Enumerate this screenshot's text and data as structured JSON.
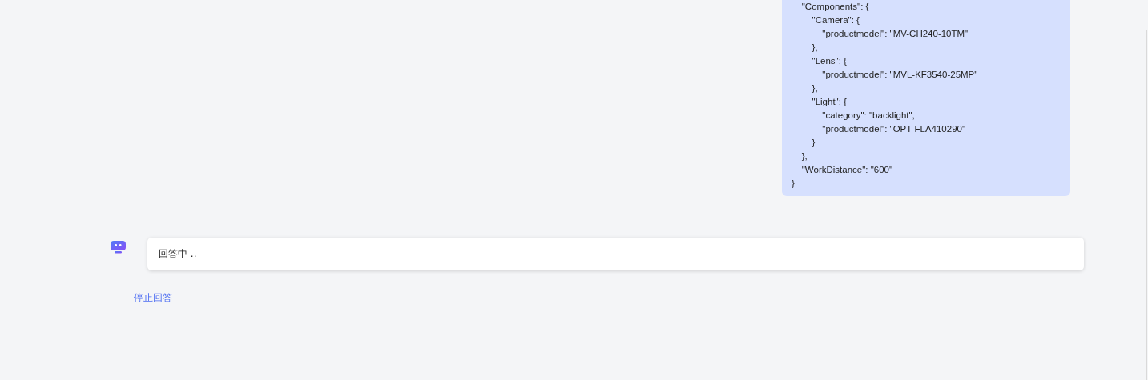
{
  "user_message": {
    "code": "    \"Components\": {\n        \"Camera\": {\n            \"productmodel\": \"MV-CH240-10TM\"\n        },\n        \"Lens\": {\n            \"productmodel\": \"MVL-KF3540-25MP\"\n        },\n        \"Light\": {\n            \"category\": \"backlight\",\n            \"productmodel\": \"OPT-FLA410290\"\n        }\n    },\n    \"WorkDistance\": \"600\"\n}"
  },
  "bot_message": {
    "text": "回答中 ..",
    "stop_link": "停止回答"
  }
}
